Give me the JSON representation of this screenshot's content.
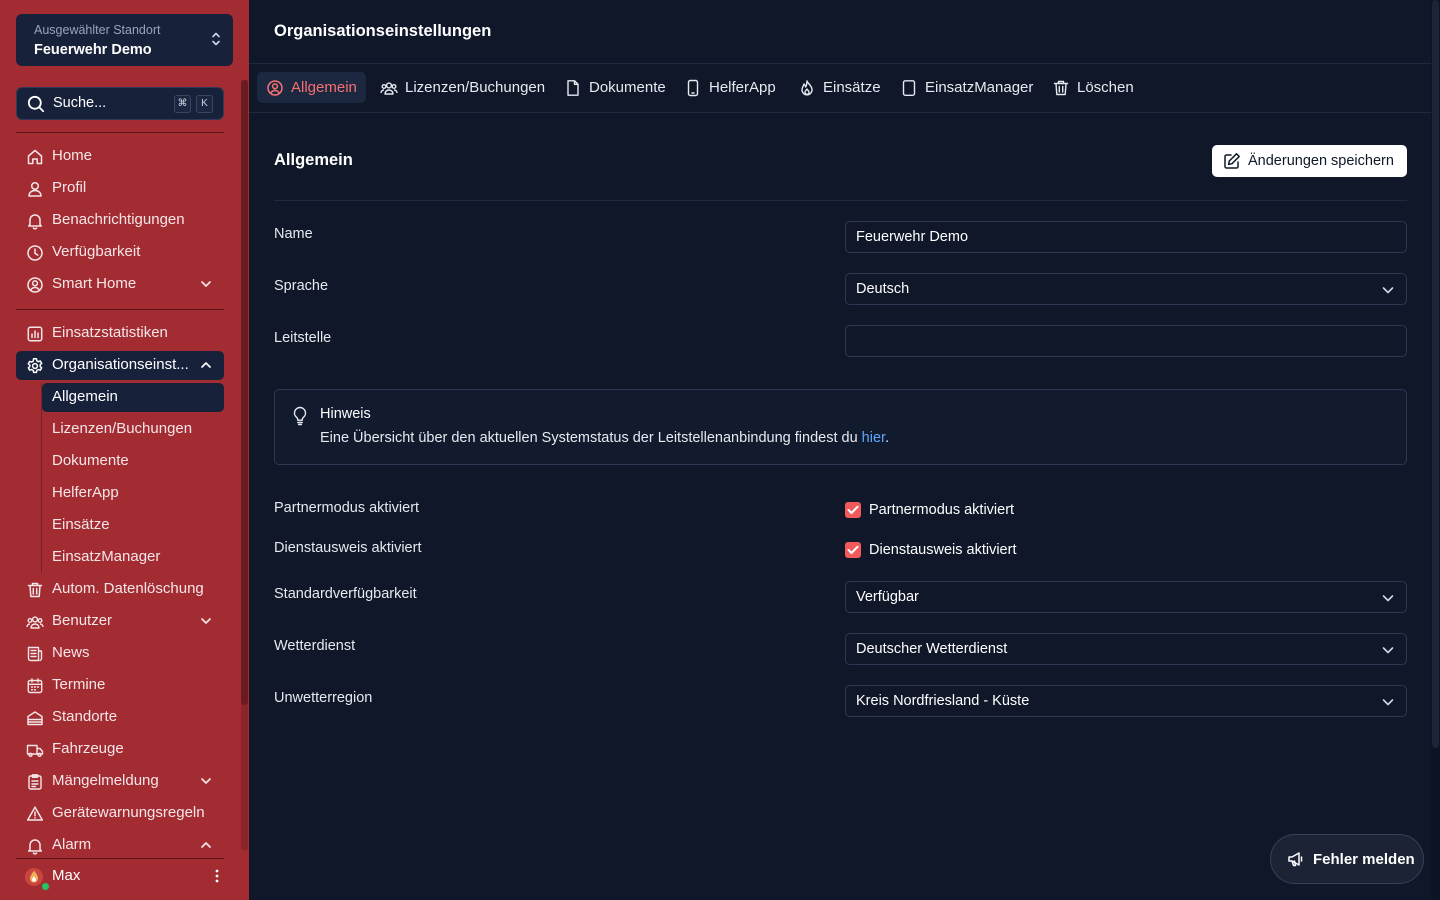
{
  "sidebar": {
    "location_label": "Ausgewählter Standort",
    "location_value": "Feuerwehr Demo",
    "search_placeholder": "Suche...",
    "search_kbd_1": "⌘",
    "search_kbd_2": "K",
    "items": [
      {
        "label": "Home",
        "icon": "home-icon"
      },
      {
        "label": "Profil",
        "icon": "user-icon"
      },
      {
        "label": "Benachrichtigungen",
        "icon": "bell-icon"
      },
      {
        "label": "Verfügbarkeit",
        "icon": "clock-icon"
      },
      {
        "label": "Smart Home",
        "icon": "user-circle-icon"
      },
      {
        "label": "Einsatzstatistiken",
        "icon": "chart-icon"
      },
      {
        "label": "Organisationseinst...",
        "icon": "gear-icon"
      },
      {
        "label": "Autom. Datenlöschung",
        "icon": "trash-icon"
      },
      {
        "label": "Benutzer",
        "icon": "users-icon"
      },
      {
        "label": "News",
        "icon": "newspaper-icon"
      },
      {
        "label": "Termine",
        "icon": "calendar-icon"
      },
      {
        "label": "Standorte",
        "icon": "building-icon"
      },
      {
        "label": "Fahrzeuge",
        "icon": "truck-icon"
      },
      {
        "label": "Mängelmeldung",
        "icon": "clipboard-icon"
      },
      {
        "label": "Gerätewarnungsregeln",
        "icon": "warning-icon"
      },
      {
        "label": "Alarm",
        "icon": "bell-icon"
      }
    ],
    "sub_items": [
      "Allgemein",
      "Lizenzen/Buchungen",
      "Dokumente",
      "HelferApp",
      "Einsätze",
      "EinsatzManager"
    ],
    "user_name": "Max"
  },
  "main": {
    "page_title": "Organisationseinstellungen",
    "tabs": [
      {
        "label": "Allgemein",
        "icon": "user-circle-icon"
      },
      {
        "label": "Lizenzen/Buchungen",
        "icon": "users-icon"
      },
      {
        "label": "Dokumente",
        "icon": "document-icon"
      },
      {
        "label": "HelferApp",
        "icon": "phone-icon"
      },
      {
        "label": "Einsätze",
        "icon": "flame-icon"
      },
      {
        "label": "EinsatzManager",
        "icon": "tablet-icon"
      },
      {
        "label": "Löschen",
        "icon": "trash-icon"
      }
    ],
    "section_title": "Allgemein",
    "save_label": "Änderungen speichern",
    "fields": {
      "name_label": "Name",
      "name_value": "Feuerwehr Demo",
      "language_label": "Sprache",
      "language_value": "Deutsch",
      "dispatch_label": "Leitstelle",
      "dispatch_value": "",
      "partner_label": "Partnermodus aktiviert",
      "partner_checkbox_label": "Partnermodus aktiviert",
      "partner_checked": true,
      "badge_label": "Dienstausweis aktiviert",
      "badge_checkbox_label": "Dienstausweis aktiviert",
      "badge_checked": true,
      "availability_label": "Standardverfügbarkeit",
      "availability_value": "Verfügbar",
      "weather_label": "Wetterdienst",
      "weather_value": "Deutscher Wetterdienst",
      "region_label": "Unwetterregion",
      "region_value": "Kreis Nordfriesland - Küste"
    },
    "hint": {
      "title": "Hinweis",
      "text": "Eine Übersicht über den aktuellen Systemstatus der Leitstellenanbindung findest du ",
      "link": "hier",
      "suffix": "."
    },
    "report_label": "Fehler melden"
  },
  "colors": {
    "sidebar_bg": "#a32c33",
    "main_bg": "#0f1729",
    "accent": "#f87171",
    "checkbox": "#f05a5a",
    "link": "#60a5fa"
  }
}
